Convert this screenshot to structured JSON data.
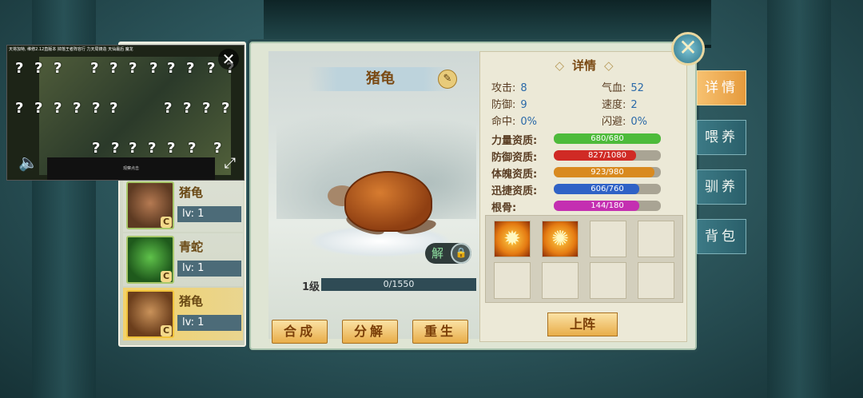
{
  "pet_list": [
    {
      "name": "猪龟",
      "level": "lv: 1",
      "grade": "C",
      "selected": false
    },
    {
      "name": "青蛇",
      "level": "lv: 1",
      "grade": "C",
      "selected": false
    },
    {
      "name": "猪龟",
      "level": "lv: 1",
      "grade": "C",
      "selected": true
    }
  ],
  "video": {
    "close_icon": "close-icon",
    "sound_icon": "speaker-icon",
    "expand_icon": "expand-icon",
    "hidden_mark": "?",
    "top_text": "天将加特, 维修2.12直版本 掉落王者阵容行\n力天局铸造 天仙最后 魔龙",
    "hud_text": "观察点击"
  },
  "pet": {
    "name": "猪龟",
    "edit_icon": "edit-icon",
    "unlock_label": "解",
    "lock_icon": "lock-icon",
    "level_label": "1级",
    "exp_text": "0/1550"
  },
  "actions": {
    "merge": "合成",
    "decompose": "分解",
    "rebirth": "重生"
  },
  "detail": {
    "title": "详情",
    "stats": {
      "attack_label": "攻击:",
      "attack": "8",
      "hp_label": "气血:",
      "hp": "52",
      "defense_label": "防御:",
      "defense": "9",
      "speed_label": "速度:",
      "speed": "2",
      "hit_label": "命中:",
      "hit": "0%",
      "dodge_label": "闪避:",
      "dodge": "0%"
    },
    "aptitudes": [
      {
        "label": "力量资质:",
        "value": 680,
        "max": 680,
        "text": "680/680",
        "color": "#4dbb3a"
      },
      {
        "label": "防御资质:",
        "value": 827,
        "max": 1080,
        "text": "827/1080",
        "color": "#d02a25"
      },
      {
        "label": "体魄资质:",
        "value": 923,
        "max": 980,
        "text": "923/980",
        "color": "#d98a1f"
      },
      {
        "label": "迅捷资质:",
        "value": 606,
        "max": 760,
        "text": "606/760",
        "color": "#2f62c6"
      },
      {
        "label": "根骨:",
        "value": 144,
        "max": 180,
        "text": "144/180",
        "color": "#c42fb1"
      }
    ],
    "skills_filled": 2,
    "skill_icon_1": "flame-skill-icon",
    "skill_icon_2": "blast-skill-icon",
    "deploy_label": "上阵"
  },
  "close_main": "close-icon",
  "side_tabs": [
    {
      "label": "详情",
      "active": true
    },
    {
      "label": "喂养",
      "active": false
    },
    {
      "label": "驯养",
      "active": false
    },
    {
      "label": "背包",
      "active": false
    }
  ]
}
